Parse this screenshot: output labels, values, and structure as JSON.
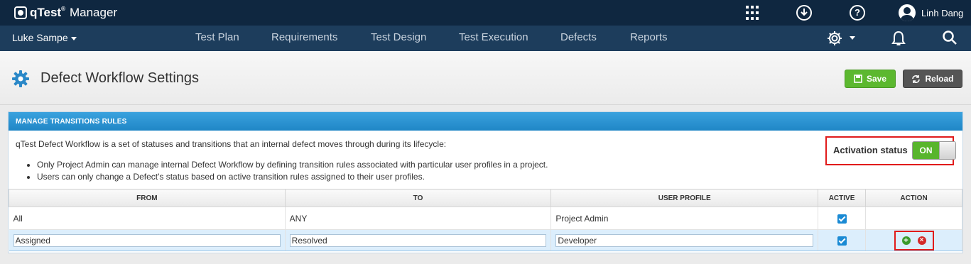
{
  "app": {
    "brand": "qTest",
    "trademark": "®",
    "product": "Manager",
    "user_name": "Linh Dang"
  },
  "nav": {
    "project": "Luke Sampe",
    "items": [
      "Test Plan",
      "Requirements",
      "Test Design",
      "Test Execution",
      "Defects",
      "Reports"
    ]
  },
  "page": {
    "title": "Defect Workflow Settings",
    "save_label": "Save",
    "reload_label": "Reload"
  },
  "panel": {
    "header": "MANAGE TRANSITIONS RULES",
    "intro": "qTest Defect Workflow is a set of statuses and transitions that an internal defect moves through during its lifecycle:",
    "bullets": [
      "Only Project Admin can manage internal Defect Workflow by defining transition rules associated with particular user profiles in a project.",
      "Users can only change a Defect's status based on active transition rules assigned to their user profiles."
    ],
    "activation_label": "Activation status",
    "activation_value": "ON"
  },
  "table": {
    "columns": [
      "FROM",
      "TO",
      "USER PROFILE",
      "ACTIVE",
      "ACTION"
    ],
    "rows": [
      {
        "from": "All",
        "to": "ANY",
        "user_profile": "Project Admin",
        "active": true
      },
      {
        "from": "Assigned",
        "to": "Resolved",
        "user_profile": "Developer",
        "active": true
      }
    ]
  },
  "colors": {
    "topbar": "#0f2740",
    "navbar": "#1d3d5c",
    "panel_header": "#2a94d3",
    "save": "#5cb82f",
    "toggle_on": "#58b52c",
    "highlight": "#e11b1b"
  },
  "icons": [
    "apps-grid-icon",
    "download-icon",
    "help-icon",
    "avatar",
    "gear-icon",
    "bell-icon",
    "search-icon",
    "save-icon",
    "reload-icon",
    "add-icon",
    "remove-icon",
    "checkbox-checked-icon"
  ]
}
